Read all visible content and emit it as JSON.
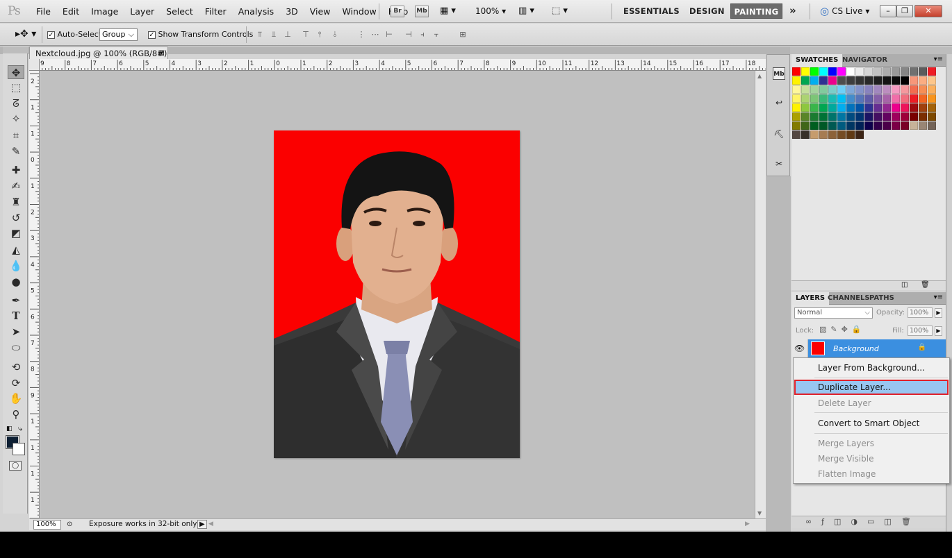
{
  "app": {
    "logo": "Ps"
  },
  "menu": [
    "File",
    "Edit",
    "Image",
    "Layer",
    "Select",
    "Filter",
    "Analysis",
    "3D",
    "View",
    "Window",
    "Help"
  ],
  "menubar_buttons": {
    "bridge": "Br",
    "mini_bridge": "Mb",
    "zoom": "100%"
  },
  "workspaces": {
    "essentials": "ESSENTIALS",
    "design": "DESIGN",
    "painting": "PAINTING",
    "more": "»"
  },
  "cs_live": "CS Live",
  "window_controls": {
    "minimize": "–",
    "restore": "❐",
    "close": "✕"
  },
  "options": {
    "auto_select_label": "Auto-Select:",
    "auto_select_value": "Group",
    "show_transform_label": "Show Transform Controls"
  },
  "document": {
    "tab_title": "Nextcloud.jpg @ 100% (RGB/8#)",
    "close": "⊠"
  },
  "ruler_top_labels": [
    "9",
    "8",
    "7",
    "6",
    "5",
    "4",
    "3",
    "2",
    "1",
    "0",
    "1",
    "2",
    "3",
    "4",
    "5",
    "6",
    "7",
    "8",
    "9",
    "10",
    "11",
    "12",
    "13",
    "14",
    "15",
    "16",
    "17",
    "18"
  ],
  "ruler_left_labels": [
    "2",
    "1",
    "1",
    "0",
    "1",
    "2",
    "3",
    "4",
    "5",
    "6",
    "7",
    "8",
    "9",
    "1",
    "1",
    "1",
    "1",
    "1"
  ],
  "status": {
    "zoom": "100%",
    "text": "Exposure works in 32-bit only"
  },
  "panels": {
    "swatches_tab": "SWATCHES",
    "navigator_tab": "NAVIGATOR",
    "layers_tab": "LAYERS",
    "channels_tab": "CHANNELS",
    "paths_tab": "PATHS",
    "blend_mode": "Normal",
    "opacity_label": "Opacity:",
    "opacity_value": "100%",
    "lock_label": "Lock:",
    "fill_label": "Fill:",
    "fill_value": "100%",
    "layer_name": "Background"
  },
  "swatch_colors": [
    "#ff0000",
    "#ffff00",
    "#00ff00",
    "#00ffff",
    "#0000ff",
    "#ff00ff",
    "#ffffff",
    "#ebebeb",
    "#d6d6d6",
    "#c2c2c2",
    "#adadad",
    "#999999",
    "#858585",
    "#707070",
    "#5c5c5c",
    "#ee1c24",
    "#fff200",
    "#00a651",
    "#00aeef",
    "#2e3192",
    "#ec008c",
    "#4d4d4d",
    "#3d3d3d",
    "#333333",
    "#292929",
    "#1f1f1f",
    "#141414",
    "#0a0a0a",
    "#000000",
    "#f7977a",
    "#fbad82",
    "#fdc68a",
    "#fff79a",
    "#c4df9b",
    "#a2d39c",
    "#82ca9d",
    "#7bcdc8",
    "#6ecff6",
    "#7ea7d8",
    "#8493ca",
    "#8882be",
    "#a187be",
    "#bc8dbf",
    "#f49ac1",
    "#f5989d",
    "#f26c4f",
    "#f68e55",
    "#fbaf5c",
    "#fff467",
    "#acd372",
    "#7cc576",
    "#3bb878",
    "#1abbb4",
    "#00bff3",
    "#438ccb",
    "#5574b9",
    "#605ca8",
    "#855fa8",
    "#a763a8",
    "#f06ea9",
    "#f26d7d",
    "#ed1c24",
    "#f26522",
    "#f7941d",
    "#fff200",
    "#8dc73f",
    "#39b54a",
    "#00a651",
    "#00a99d",
    "#00aeef",
    "#0072bc",
    "#0054a6",
    "#2e3192",
    "#662d91",
    "#92278f",
    "#ec008c",
    "#ed145b",
    "#9e0b0f",
    "#a0410d",
    "#a36209",
    "#aba000",
    "#598527",
    "#1a7b30",
    "#007236",
    "#00746b",
    "#0076a3",
    "#004b80",
    "#003471",
    "#1b1464",
    "#440e62",
    "#630460",
    "#9e005d",
    "#9e0039",
    "#790000",
    "#7b2e00",
    "#7d4900",
    "#827b00",
    "#406618",
    "#005e20",
    "#005826",
    "#005952",
    "#005b7f",
    "#003663",
    "#002157",
    "#0d004c",
    "#32004b",
    "#4b0049",
    "#7b0046",
    "#7a0026",
    "#c7b299",
    "#998675",
    "#736357",
    "#534741",
    "#37302a",
    "#c69c6d",
    "#a67c52",
    "#8c6239",
    "#754c24",
    "#603913",
    "#3c2415"
  ],
  "context_menu": {
    "layer_from_bg": "Layer From Background...",
    "duplicate": "Duplicate Layer...",
    "delete": "Delete Layer",
    "smart_object": "Convert to Smart Object",
    "merge_layers": "Merge Layers",
    "merge_visible": "Merge Visible",
    "flatten": "Flatten Image"
  },
  "colors": {
    "accent": "#3b8fe0",
    "highlight_border": "#e0202a",
    "canvas_bg": "#c0c0c0",
    "photo_bg": "#fb0000"
  }
}
